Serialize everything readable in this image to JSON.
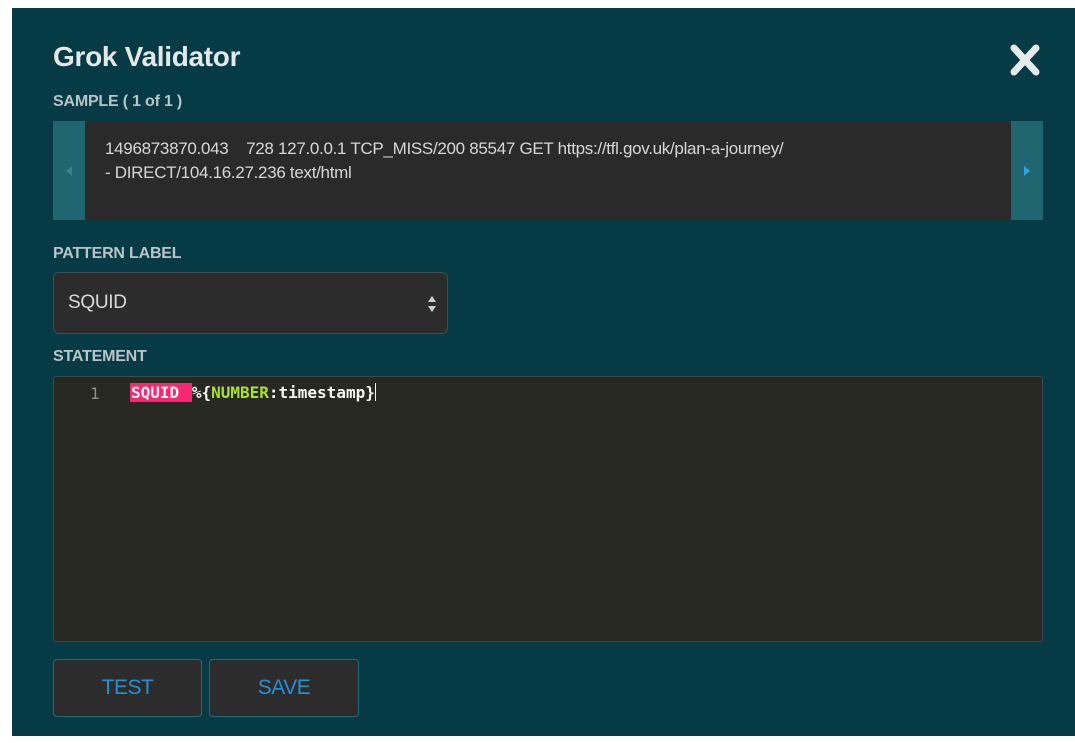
{
  "dialog": {
    "title": "Grok Validator",
    "close_icon": "close-icon"
  },
  "sample": {
    "label": "SAMPLE ( 1 of 1 )",
    "text": "1496873870.043    728 127.0.0.1 TCP_MISS/200 85547 GET https://tfl.gov.uk/plan-a-journey/\n- DIRECT/104.16.27.236 text/html",
    "prev_icon": "caret-left-icon",
    "next_icon": "caret-right-icon"
  },
  "pattern": {
    "label": "PATTERN LABEL",
    "selected": "SQUID",
    "arrows_icon": "select-arrows-icon"
  },
  "statement": {
    "label": "STATEMENT",
    "line_number": "1",
    "tokens": {
      "keyword": "SQUID",
      "space": " ",
      "open": "%{",
      "type": "NUMBER",
      "colon": ":",
      "name": "timestamp",
      "close": "}"
    }
  },
  "actions": {
    "test_label": "TEST",
    "save_label": "SAVE"
  },
  "colors": {
    "dialog_bg": "#063a44",
    "accent": "#2b8fd0",
    "keyword_bg": "#f92672",
    "type_color": "#a6e22e"
  }
}
